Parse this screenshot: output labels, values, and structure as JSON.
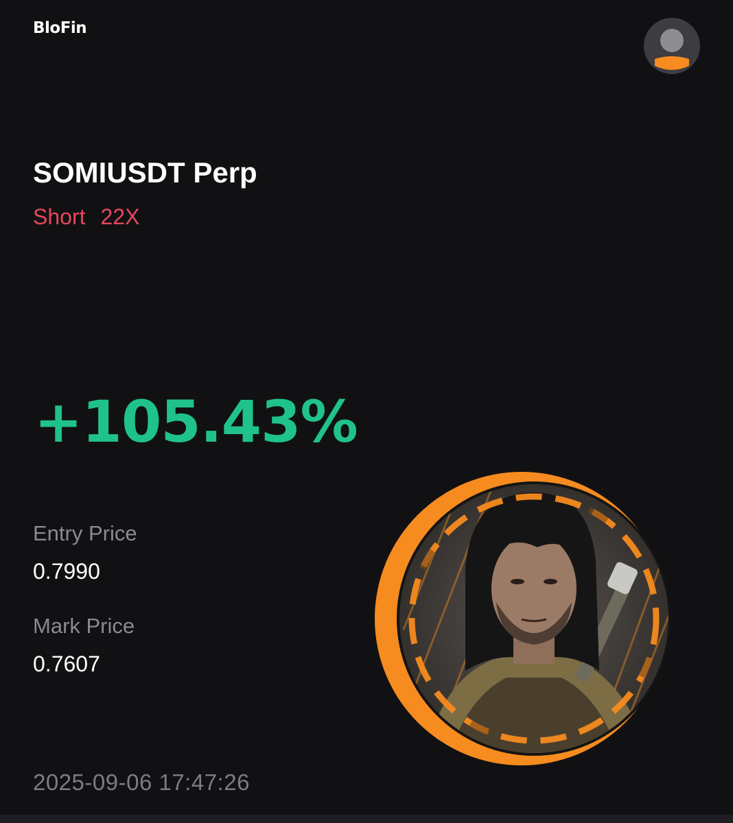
{
  "brand": {
    "logo_text": "BloFin"
  },
  "header": {
    "profile_icon": "user-avatar-icon"
  },
  "position": {
    "pair": "SOMIUSDT Perp",
    "side": "Short",
    "leverage": "22X",
    "pnl_percent": "+105.43%"
  },
  "prices": {
    "entry_label": "Entry Price",
    "entry_value": "0.7990",
    "mark_label": "Mark Price",
    "mark_value": "0.7607"
  },
  "timestamp": "2025-09-06 17:47:26",
  "badge": {
    "icon": "character-portrait-badge"
  },
  "colors": {
    "background": "#111113",
    "short": "#e5485d",
    "profit": "#1fc38a",
    "accent": "#f68b1f",
    "muted": "#8a8a90"
  }
}
